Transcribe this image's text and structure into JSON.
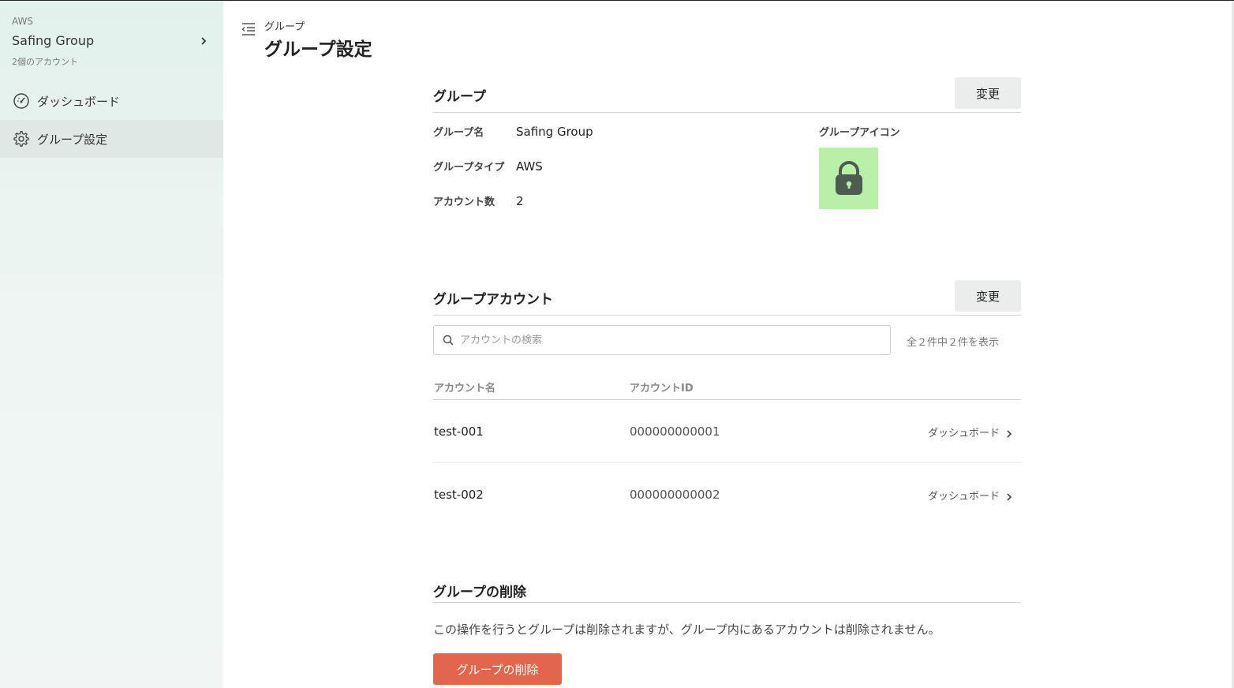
{
  "sidebar": {
    "group_type": "AWS",
    "group_name": "Safing Group",
    "account_count": "2個のアカウント",
    "items": [
      {
        "label": "ダッシュボード",
        "icon": "gauge-icon"
      },
      {
        "label": "グループ設定",
        "icon": "gear-icon",
        "active": true
      }
    ]
  },
  "header": {
    "breadcrumb": "グループ",
    "title": "グループ設定"
  },
  "group_section": {
    "title": "グループ",
    "change_label": "変更",
    "fields": [
      {
        "label": "グループ名",
        "value": "Safing Group"
      },
      {
        "label": "グループタイプ",
        "value": "AWS"
      },
      {
        "label": "アカウント数",
        "value": "2"
      }
    ],
    "icon_label": "グループアイコン",
    "icon_color": "#b7f0a6"
  },
  "accounts_section": {
    "title": "グループアカウント",
    "change_label": "変更",
    "search_placeholder": "アカウントの検索",
    "result_count": "全２件中２件を表示",
    "columns": [
      "アカウント名",
      "アカウントID"
    ],
    "rows": [
      {
        "name": "test-001",
        "id": "000000000001",
        "link": "ダッシュボード"
      },
      {
        "name": "test-002",
        "id": "000000000002",
        "link": "ダッシュボード"
      }
    ]
  },
  "delete_section": {
    "title": "グループの削除",
    "description": "この操作を行うとグループは削除されますが、グループ内にあるアカウントは削除されません。",
    "button_label": "グループの削除",
    "button_color": "#e2654d"
  }
}
